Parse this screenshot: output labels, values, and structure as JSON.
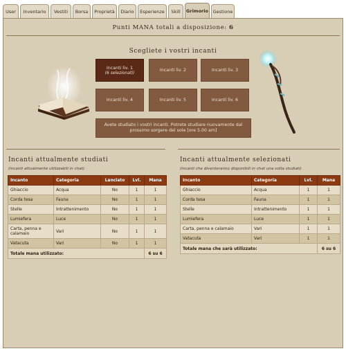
{
  "tabs": [
    "User",
    "Inventario",
    "Vestiti",
    "Borsa",
    "Proprietà",
    "Diario",
    "Esperienze",
    "Skill",
    "Grimorio",
    "Gestione"
  ],
  "active_tab": "Grimorio",
  "mana_header": {
    "label": "Punti MANA totali a disposizione:",
    "value": "6"
  },
  "choose_title": "Scegliete i vostri incanti",
  "levels": [
    {
      "label": "Incanti liv. 1",
      "sub": "(6 selezionati)"
    },
    {
      "label": "Incanti liv. 2",
      "sub": ""
    },
    {
      "label": "Incanti liv. 3",
      "sub": ""
    },
    {
      "label": "Incanti liv. 4",
      "sub": ""
    },
    {
      "label": "Incanti liv. 5",
      "sub": ""
    },
    {
      "label": "Incanti liv. 6",
      "sub": ""
    }
  ],
  "studied_note": "Avete studiato i vostri incanti. Potrete studiare nuovamente dal prossimo sorgere del sole [ore 5.00 am]",
  "studied": {
    "title": "Incanti attualmente studiati",
    "subtitle": "(incanti attualmente utilizzabili in chat)",
    "headers": [
      "Incanto",
      "Categoria",
      "Lanciato",
      "Lvl.",
      "Mana"
    ],
    "rows": [
      [
        "Ghiaccio",
        "Acqua",
        "No",
        "1",
        "1"
      ],
      [
        "Corda tesa",
        "Fauna",
        "No",
        "1",
        "1"
      ],
      [
        "Stelle",
        "Intrattenimento",
        "No",
        "1",
        "1"
      ],
      [
        "Lumiefera",
        "Luce",
        "No",
        "1",
        "1"
      ],
      [
        "Carta, penna e calamaio",
        "Vari",
        "No",
        "1",
        "1"
      ],
      [
        "Vatacuta",
        "Vari",
        "No",
        "1",
        "1"
      ]
    ],
    "total_label": "Totale mana utilizzato:",
    "total_value": "6 su 6"
  },
  "selected": {
    "title": "Incanti attualmente selezionati",
    "subtitle": "(incanti che diventeranno disponibili in chat una volta studiati)",
    "headers": [
      "Incanto",
      "Categoria",
      "Lvl.",
      "Mana"
    ],
    "rows": [
      [
        "Ghiaccio",
        "Acqua",
        "1",
        "1"
      ],
      [
        "Corda tesa",
        "Fauna",
        "1",
        "1"
      ],
      [
        "Stelle",
        "Intrattenimento",
        "1",
        "1"
      ],
      [
        "Lumiefera",
        "Luce",
        "1",
        "1"
      ],
      [
        "Carta, penna e calamaio",
        "Vari",
        "1",
        "1"
      ],
      [
        "Vatacuta",
        "Vari",
        "1",
        "1"
      ]
    ],
    "total_label": "Totale mana che sarà utilizzato:",
    "total_value": "6 su 6"
  },
  "colors": {
    "panel": "#d8cdb5",
    "button": "#825a3f",
    "button_active": "#5a2a17",
    "table_header": "#8b3a12"
  }
}
